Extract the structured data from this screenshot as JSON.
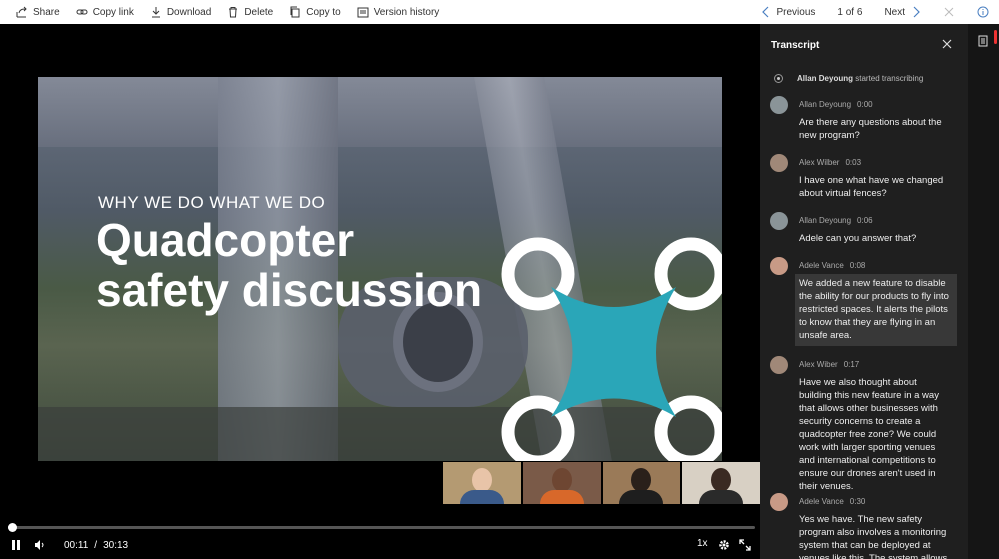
{
  "toolbar": {
    "share": "Share",
    "copy_link": "Copy link",
    "download": "Download",
    "delete": "Delete",
    "copy_to": "Copy to",
    "version_history": "Version history",
    "previous": "Previous",
    "page_indicator": "1 of 6",
    "next": "Next"
  },
  "slide": {
    "subtitle": "WHY WE DO WHAT WE DO",
    "title_line1": "Quadcopter",
    "title_line2": "safety discussion",
    "logo_color": "#2aa6b8"
  },
  "player": {
    "current_time": "00:11",
    "separator": "/",
    "duration": "30:13",
    "progress_fraction": 0.006,
    "speed": "1x"
  },
  "transcript": {
    "header": "Transcript",
    "started_name": "Allan Deyoung",
    "started_text": " started transcribing",
    "entries": [
      {
        "speaker": "Allan Deyoung",
        "time": "0:00",
        "text": "Are there any questions about the new program?"
      },
      {
        "speaker": "Alex Wilber",
        "time": "0:03",
        "text": "I have one what have we changed about virtual fences?"
      },
      {
        "speaker": "Allan Deyoung",
        "time": "0:06",
        "text": "Adele can you answer that?"
      },
      {
        "speaker": "Adele Vance",
        "time": "0:08",
        "text": "We added a new feature to disable the ability for our products to fly into restricted spaces. It alerts the pilots to know that they are flying in an unsafe area."
      },
      {
        "speaker": "Alex Wiber",
        "time": "0:17",
        "text": "Have we also thought about building this new feature in a way that allows other businesses with security concerns to create a quadcopter free zone? We could work with larger sporting venues and international competitions to ensure our drones aren't used in their venues."
      },
      {
        "speaker": "Adele Vance",
        "time": "0:30",
        "text": "Yes we have. The new safety program also involves a monitoring system that can be deployed at venues like this. The system allows them to"
      }
    ]
  }
}
